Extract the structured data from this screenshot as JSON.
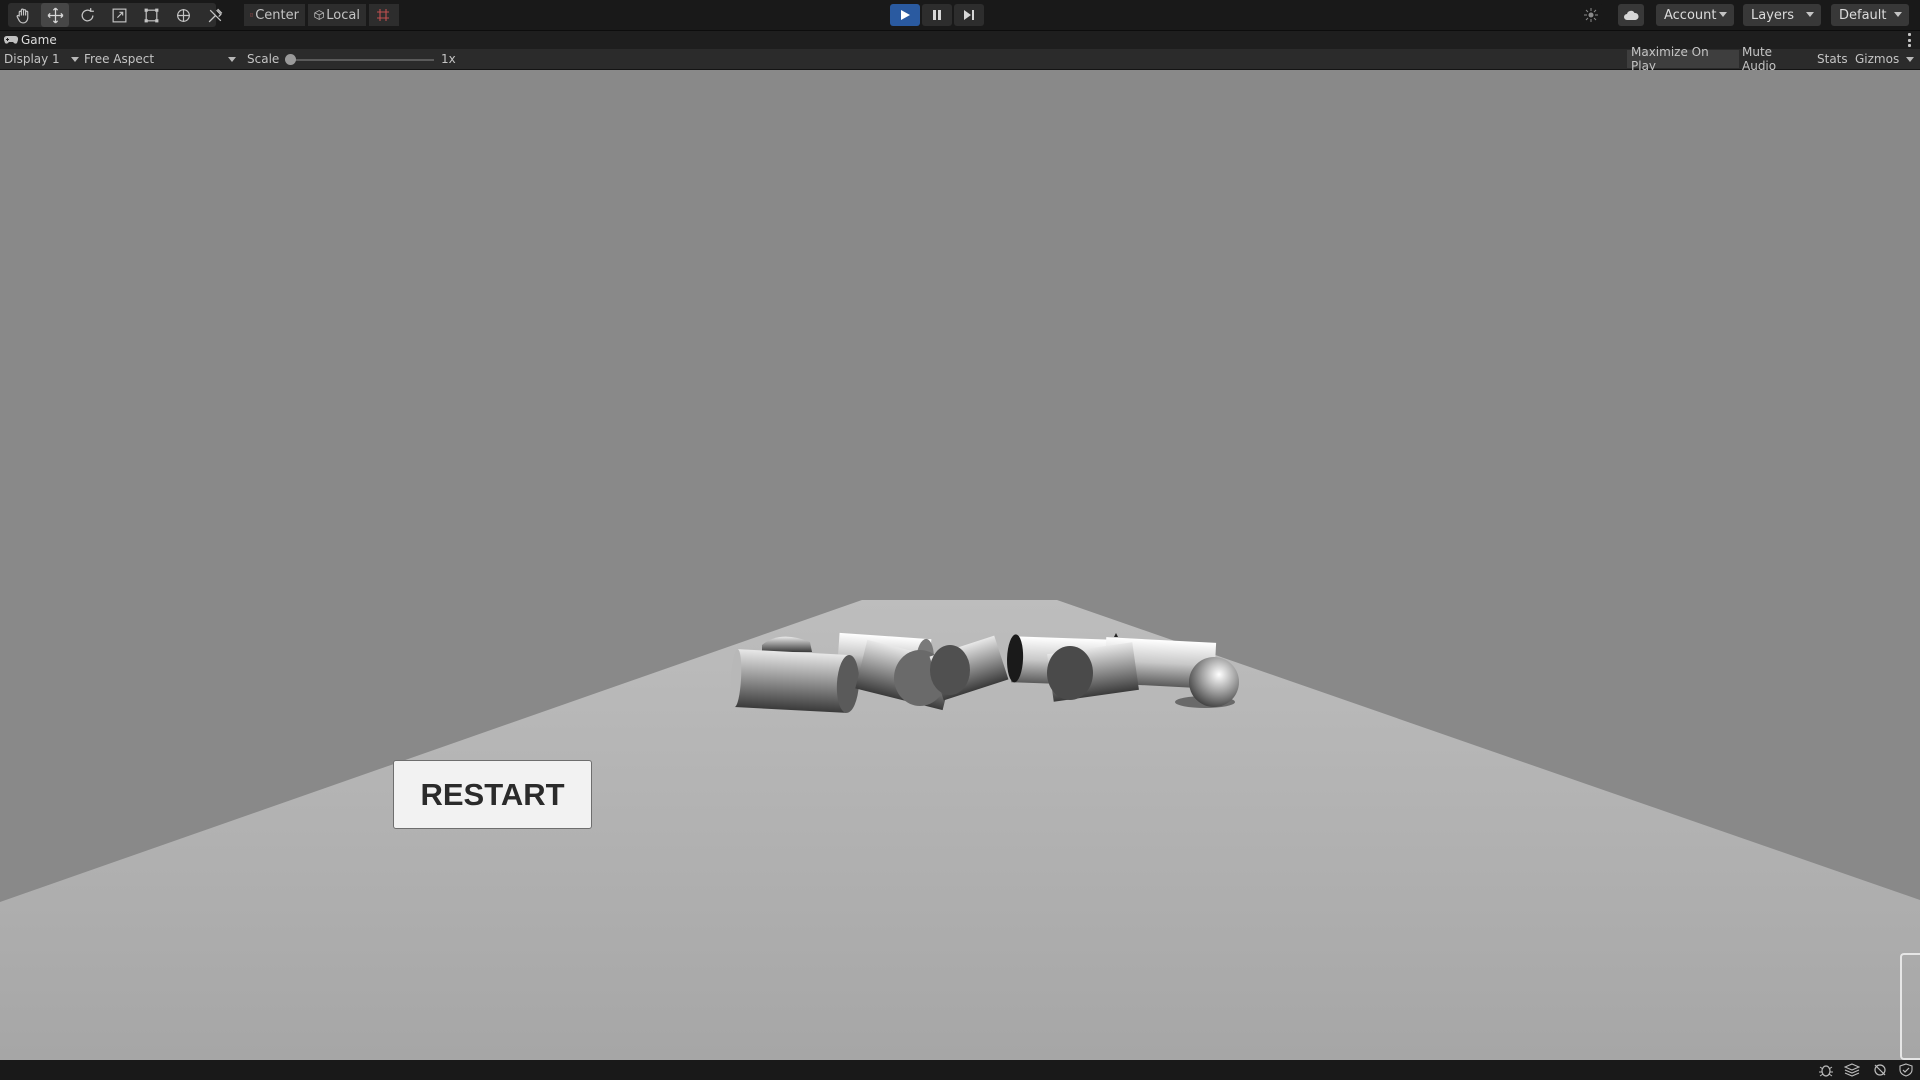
{
  "toolbar": {
    "tools": [
      "hand-tool",
      "move-tool",
      "rotate-tool",
      "scale-tool",
      "rect-tool",
      "transform-tool",
      "custom-tool"
    ],
    "active_tool": "move-tool",
    "pivot_mode": "Center",
    "pivot_rotation": "Local",
    "play_state": "playing",
    "account_label": "Account",
    "layers_label": "Layers",
    "layout_label": "Default"
  },
  "panel": {
    "tab_label": "Game"
  },
  "gamebar": {
    "display": "Display 1",
    "aspect": "Free Aspect",
    "scale_label": "Scale",
    "scale_value": "1x",
    "maximize_on_play": "Maximize On Play",
    "mute_audio": "Mute Audio",
    "stats": "Stats",
    "gizmos": "Gizmos"
  },
  "game": {
    "restart_button": "RESTART"
  },
  "colors": {
    "play_active": "#2a5aa0",
    "editor_bg": "#191919",
    "sky": "#898989",
    "ground": "#b4b4b4"
  }
}
